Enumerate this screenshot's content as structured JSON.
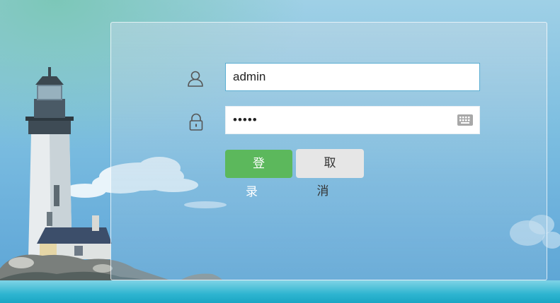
{
  "login": {
    "username_value": "admin",
    "password_value": "•••••",
    "login_label": "登 录",
    "cancel_label": "取 消"
  },
  "icons": {
    "user": "user-icon",
    "lock": "lock-icon",
    "keyboard": "keyboard-icon"
  },
  "colors": {
    "login_button": "#5cb85c",
    "cancel_button": "#e6e6e6",
    "input_border": "#5aaed2"
  }
}
